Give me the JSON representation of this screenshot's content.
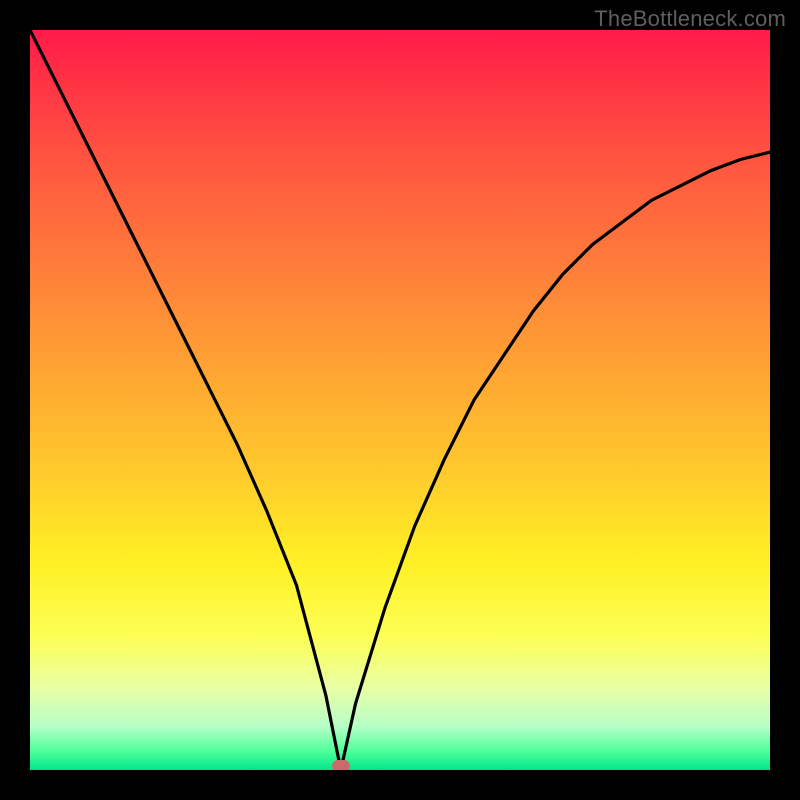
{
  "watermark": "TheBottleneck.com",
  "chart_data": {
    "type": "line",
    "title": "",
    "xlabel": "",
    "ylabel": "",
    "xlim": [
      0,
      100
    ],
    "ylim": [
      0,
      100
    ],
    "grid": false,
    "legend": false,
    "background": "rainbow-gradient (red top → green bottom, value decreases downward)",
    "marker": {
      "x": 42,
      "y": 0,
      "color": "#c96b6b"
    },
    "series": [
      {
        "name": "curve",
        "x": [
          0,
          4,
          8,
          12,
          16,
          20,
          24,
          28,
          32,
          36,
          40,
          42,
          44,
          48,
          52,
          56,
          60,
          64,
          68,
          72,
          76,
          80,
          84,
          88,
          92,
          96,
          100
        ],
        "y": [
          100,
          92,
          84,
          76,
          68,
          60,
          52,
          44,
          35,
          25,
          10,
          0,
          9,
          22,
          33,
          42,
          50,
          56,
          62,
          67,
          71,
          74,
          77,
          79,
          81,
          82.5,
          83.5
        ]
      }
    ],
    "notes": "Single V-shaped black curve dipping to y=0 at x≈42 over a vertical rainbow gradient; a small rounded pink marker sits at the minimum on the bottom edge."
  }
}
